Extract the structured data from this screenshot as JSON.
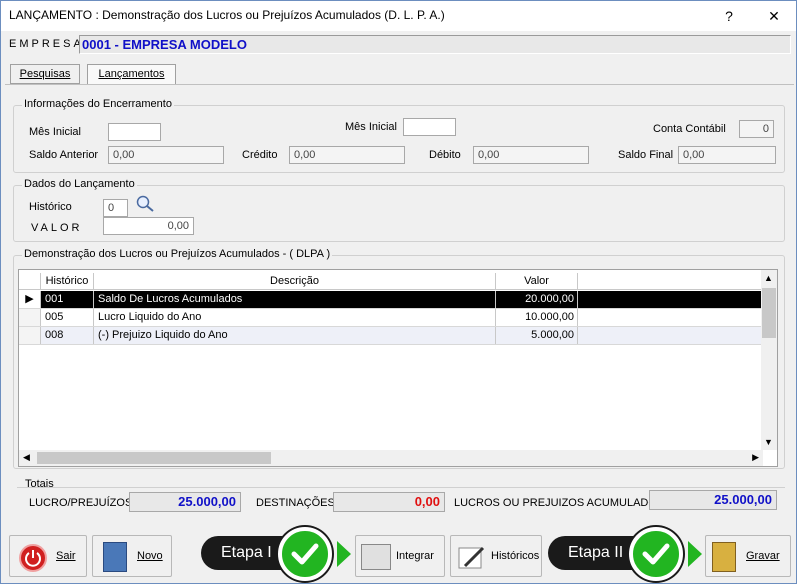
{
  "window": {
    "title": "LANÇAMENTO : Demonstração dos Lucros ou Prejuízos Acumulados (D. L. P. A.)",
    "help_label": "?",
    "close_label": "✕"
  },
  "empresa": {
    "label": "EMPRESA",
    "value": "0001 - EMPRESA MODELO"
  },
  "tabs": [
    {
      "label": "Pesquisas"
    },
    {
      "label": "Lançamentos"
    }
  ],
  "encerramento": {
    "title": "Informações do Encerramento",
    "mes_inicial_label": "Mês Inicial",
    "mes_inicial_value": "",
    "mes_inicial2_label": "Mês Inicial",
    "mes_inicial2_value": "",
    "conta_contabil_label": "Conta Contábil",
    "conta_contabil_value": "0",
    "saldo_anterior_label": "Saldo Anterior",
    "saldo_anterior_value": "0,00",
    "credito_label": "Crédito",
    "credito_value": "0,00",
    "debito_label": "Débito",
    "debito_value": "0,00",
    "saldo_final_label": "Saldo Final",
    "saldo_final_value": "0,00"
  },
  "lancamento": {
    "title": "Dados do Lançamento",
    "historico_label": "Histórico",
    "historico_value": "0",
    "valor_label": "VALOR",
    "valor_value": "0,00"
  },
  "dlpa": {
    "title": "Demonstração dos Lucros ou Prejuízos Acumulados - ( DLPA )",
    "columns": [
      "Histórico",
      "Descrição",
      "Valor"
    ],
    "rows": [
      {
        "historico": "001",
        "descricao": "Saldo De Lucros Acumulados",
        "valor": "20.000,00"
      },
      {
        "historico": "005",
        "descricao": "Lucro Liquido do Ano",
        "valor": "10.000,00"
      },
      {
        "historico": "008",
        "descricao": "(-) Prejuizo Liquido do Ano",
        "valor": "5.000,00"
      }
    ]
  },
  "totais": {
    "title": "Totais",
    "lucro_label": "LUCRO/PREJUÍZOS",
    "lucro_value": "25.000,00",
    "destinacoes_label": "DESTINAÇÕES",
    "destinacoes_value": "0,00",
    "acumulados_label": "LUCROS OU PREJUIZOS ACUMULADOS",
    "acumulados_value": "25.000,00",
    "colors": {
      "blue": "#1010c8",
      "red": "#e01010"
    }
  },
  "buttons": {
    "sair": "Sair",
    "novo": "Novo",
    "integrar": "Integrar",
    "historicos": "Históricos",
    "gravar": "Gravar"
  },
  "overlay": {
    "etapa1": "Etapa I",
    "etapa2": "Etapa II",
    "check_color": "#22b521"
  }
}
